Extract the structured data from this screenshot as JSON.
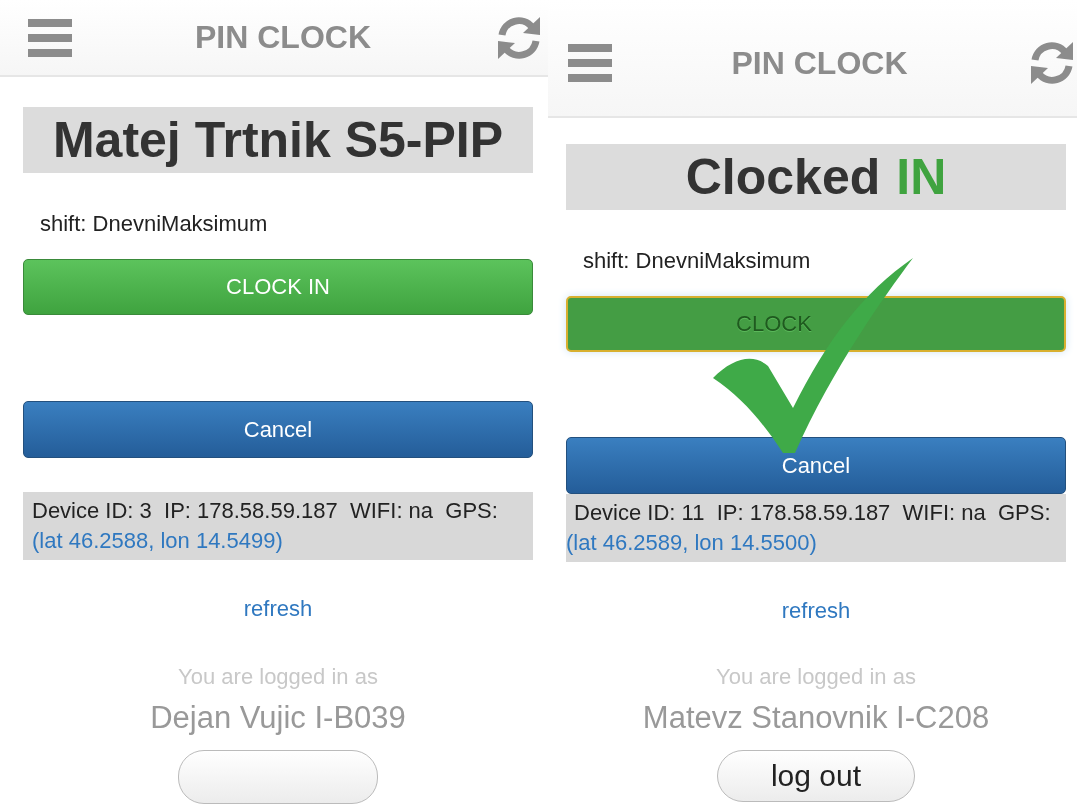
{
  "panels": [
    {
      "header": {
        "title": "PIN CLOCK"
      },
      "title_parts": [
        {
          "text": "Matej Trtnik S5-PIP",
          "color": "#333333"
        }
      ],
      "shift": "shift: DnevniMaksimum",
      "clock_button": {
        "label": "CLOCK IN",
        "disabled": false
      },
      "cancel_button": "Cancel",
      "device_info": "Device ID: 3  IP: 178.58.59.187  WIFI: na  GPS:",
      "gps_link": "(lat 46.2588, lon 14.5499)",
      "refresh_link": "refresh",
      "logged_in_label": "You are logged in as",
      "user_name": "Dejan Vujic I-B039"
    },
    {
      "header": {
        "title": "PIN CLOCK"
      },
      "title_parts": [
        {
          "text": "Clocked",
          "color": "#333333"
        },
        {
          "text": "IN",
          "color": "#3fa33f"
        }
      ],
      "shift": "shift: DnevniMaksimum",
      "clock_button": {
        "label": "CLOCK",
        "disabled": true
      },
      "cancel_button": "Cancel",
      "device_info": "Device ID: 11  IP: 178.58.59.187  WIFI: na  GPS:",
      "gps_link": "(lat 46.2589, lon 14.5500)",
      "refresh_link": "refresh",
      "logged_in_label": "You are logged in as",
      "user_name": "Matevz Stanovnik I-C208",
      "logout_button": "log out",
      "confirmed_check": true
    }
  ]
}
